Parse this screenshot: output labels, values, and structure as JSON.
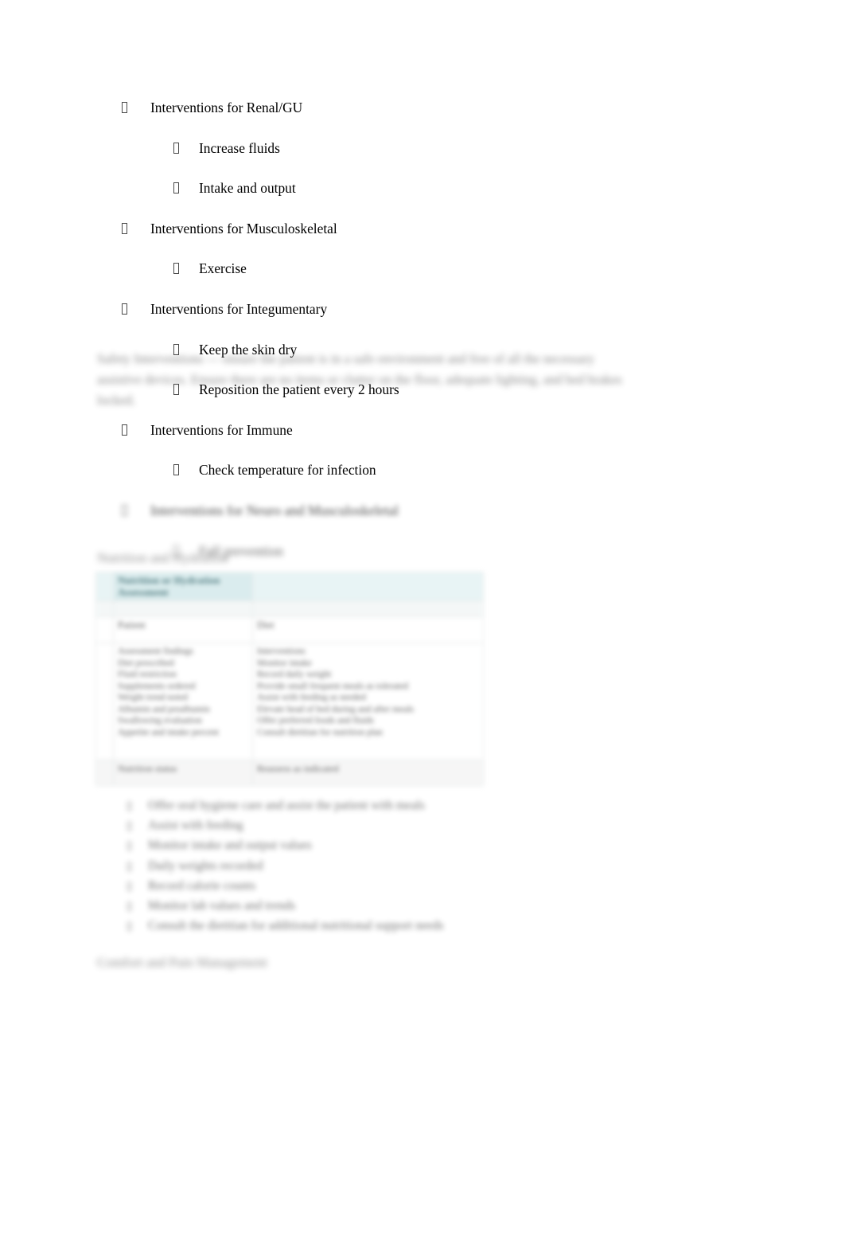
{
  "document": {
    "page_background": "#ffffff",
    "text_color": "#000000"
  },
  "outline": {
    "bullet_glyph": "missing-glyph-box",
    "items": [
      {
        "level": 1,
        "text": "Interventions for Renal/GU"
      },
      {
        "level": 2,
        "text": "Increase fluids"
      },
      {
        "level": 2,
        "text": "Intake and output"
      },
      {
        "level": 1,
        "text": "Interventions for Musculoskeletal"
      },
      {
        "level": 2,
        "text": "Exercise"
      },
      {
        "level": 1,
        "text": "Interventions for Integumentary"
      },
      {
        "level": 2,
        "text": "Keep the skin dry"
      },
      {
        "level": 2,
        "text": "Reposition the patient every 2 hours"
      },
      {
        "level": 1,
        "text": "Interventions for Immune"
      },
      {
        "level": 2,
        "text": "Check temperature for infection"
      }
    ],
    "redacted_items": [
      {
        "level": 1,
        "text": "Interventions for Neuro and Musculoskeletal"
      },
      {
        "level": 2,
        "text": "Fall prevention"
      }
    ]
  },
  "redacted_paragraph": {
    "line1": "Safety Interventions — ensure the patient is in a safe environment and free of all the necessary",
    "line2": "assistive devices. Ensure there are no items or clutter on the floor, adequate lighting, and bed brakes",
    "line3": "locked."
  },
  "section_heading_table": "Nutrition and Hydration",
  "table": {
    "header_label": "Nutrition or Hydration Assessment",
    "header_highlight_color": "#d2e8ea",
    "header_background": "#e3f2f3",
    "header_text_color": "#2b6066",
    "meta_label": "Patient",
    "meta_value": "Diet",
    "columns": [
      {
        "title": "Assessment findings"
      },
      {
        "title": "Interventions"
      }
    ],
    "body": {
      "left": [
        "Diet prescribed",
        "Fluid restriction",
        "Supplements ordered",
        "Weight trend noted",
        "Albumin and prealbumin",
        "Swallowing evaluation",
        "Appetite and intake percent"
      ],
      "right": [
        "Monitor intake",
        "Record daily weight",
        "Provide small frequent meals as tolerated",
        "Assist with feeding as needed",
        "Elevate head of bed during and after meals",
        "Offer preferred foods and fluids",
        "Consult dietitian for nutrition plan"
      ]
    },
    "footer": {
      "left": "Nutrition status",
      "right": "Reassess as indicated"
    }
  },
  "lower_list": {
    "items": [
      "Offer oral hygiene care and assist the patient with meals",
      "Assist with feeding",
      "Monitor intake and output values",
      "Daily weights recorded",
      "Record calorie counts",
      "Monitor lab values and trends",
      "Consult the dietitian for additional nutritional support needs"
    ]
  },
  "section_heading_bottom": "Comfort and Pain Management"
}
